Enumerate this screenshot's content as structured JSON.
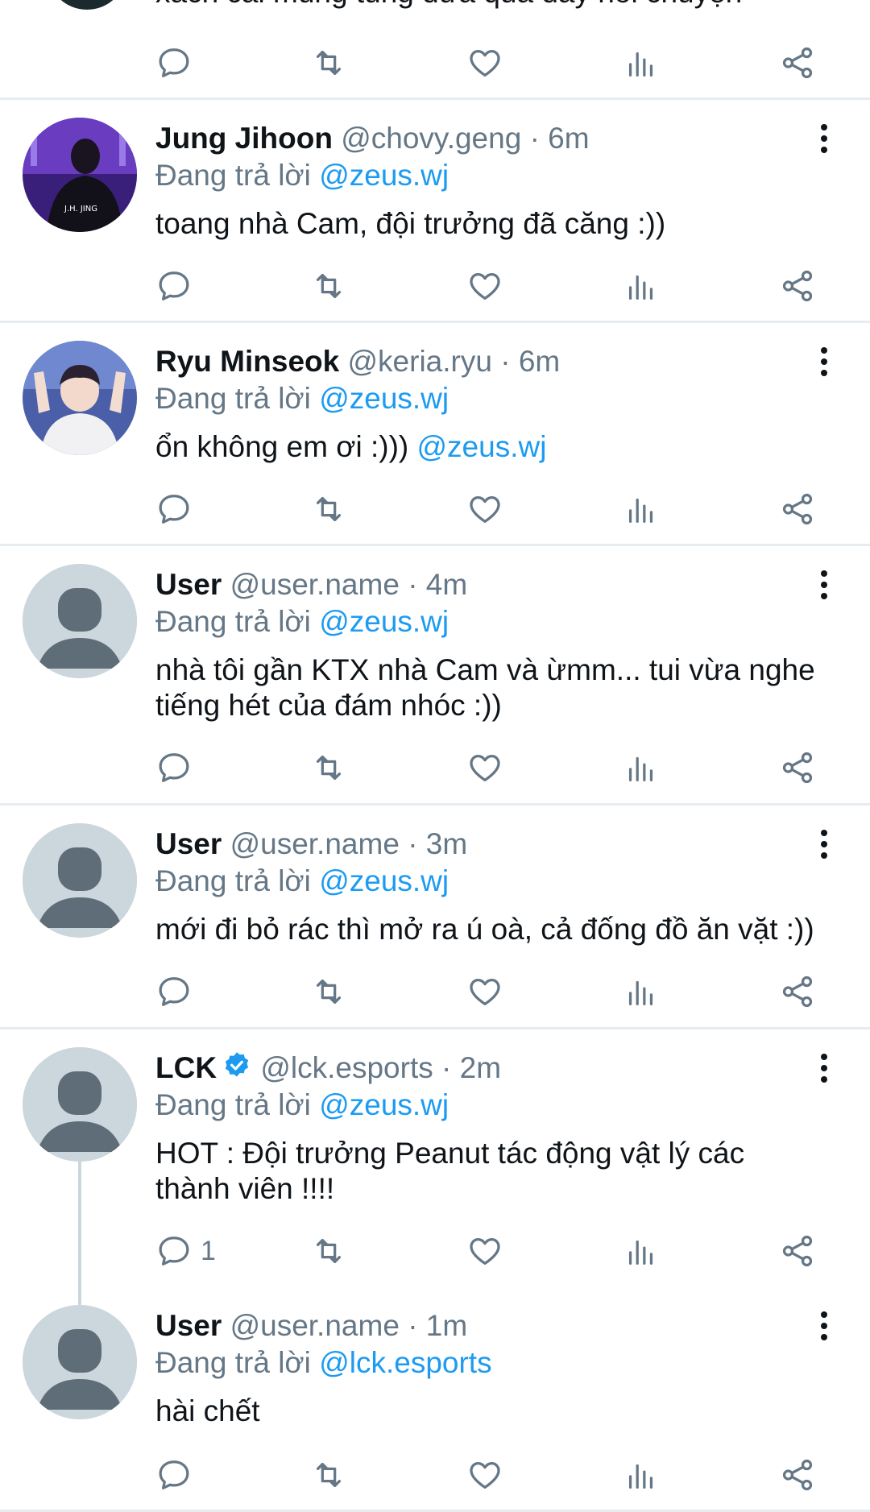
{
  "top": {
    "text": "xách cái mùng tung đưa qua đây nói chuyện"
  },
  "replying_prefix": "Đang trả lời",
  "tweets": [
    {
      "name": "Jung Jihoon",
      "handle": "@chovy.geng",
      "time": "· 6m",
      "reply_to": "@zeus.wj",
      "text": "toang nhà Cam, đội trưởng đã căng :))"
    },
    {
      "name": "Ryu Minseok",
      "handle": "@keria.ryu",
      "time": "· 6m",
      "reply_to": "@zeus.wj",
      "text": "ổn không em ơi :)))",
      "mention": "@zeus.wj"
    },
    {
      "name": "User",
      "handle": "@user.name",
      "time": "· 4m",
      "reply_to": "@zeus.wj",
      "text": "nhà tôi gần KTX nhà Cam và ừmm... tui vừa nghe tiếng hét của đám nhóc :))"
    },
    {
      "name": "User",
      "handle": "@user.name",
      "time": "· 3m",
      "reply_to": "@zeus.wj",
      "text": "mới đi bỏ rác thì mở ra ú oà, cả đống đồ ăn vặt :))"
    },
    {
      "name": "LCK",
      "handle": "@lck.esports",
      "time": "· 2m",
      "reply_to": "@zeus.wj",
      "text": "HOT : Đội trưởng Peanut tác động vật lý các thành viên !!!!",
      "reply_count": "1",
      "verified": true
    },
    {
      "name": "User",
      "handle": "@user.name",
      "time": "· 1m",
      "reply_to": "@lck.esports",
      "text": "hài chết"
    }
  ],
  "colors": {
    "accent": "#1d9bf0",
    "secondary_text": "#657786",
    "divider": "#e6ecf0",
    "placeholder_avatar": "#ccd6dd"
  }
}
